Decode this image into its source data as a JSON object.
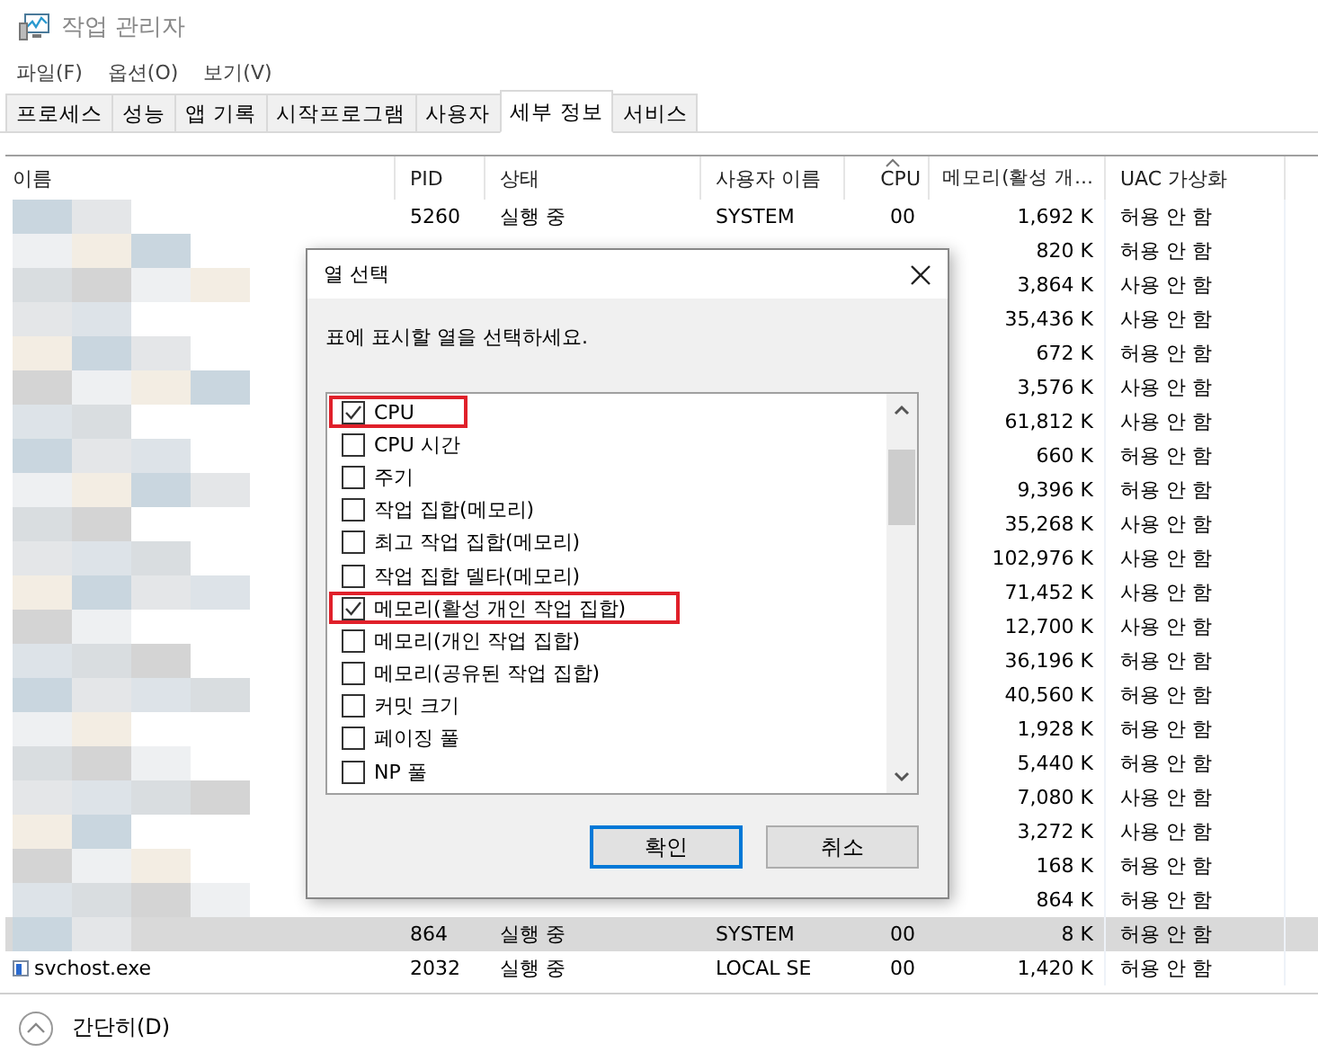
{
  "window": {
    "title": "작업 관리자"
  },
  "menu": [
    "파일(F)",
    "옵션(O)",
    "보기(V)"
  ],
  "tabs": [
    {
      "label": "프로세스",
      "selected": false
    },
    {
      "label": "성능",
      "selected": false
    },
    {
      "label": "앱 기록",
      "selected": false
    },
    {
      "label": "시작프로그램",
      "selected": false
    },
    {
      "label": "사용자",
      "selected": false
    },
    {
      "label": "세부 정보",
      "selected": true
    },
    {
      "label": "서비스",
      "selected": false
    }
  ],
  "table": {
    "columns": [
      {
        "label": "이름",
        "sorted": false
      },
      {
        "label": "PID",
        "sorted": false
      },
      {
        "label": "상태",
        "sorted": false
      },
      {
        "label": "사용자 이름",
        "sorted": false
      },
      {
        "label": "CPU",
        "sorted": true
      },
      {
        "label": "메모리(활성 개…",
        "sorted": false
      },
      {
        "label": "UAC 가상화",
        "sorted": false
      }
    ],
    "rows": [
      {
        "blurred": true,
        "selected": false,
        "pid": "5260",
        "status": "실행 중",
        "user": "SYSTEM",
        "cpu": "00",
        "memory": "1,692 K",
        "uac": "허용 안 함"
      },
      {
        "blurred": true,
        "selected": false,
        "memory": "820 K",
        "uac": "허용 안 함"
      },
      {
        "blurred": true,
        "selected": false,
        "memory": "3,864 K",
        "uac": "사용 안 함"
      },
      {
        "blurred": true,
        "selected": false,
        "memory": "35,436 K",
        "uac": "사용 안 함"
      },
      {
        "blurred": true,
        "selected": false,
        "memory": "672 K",
        "uac": "허용 안 함"
      },
      {
        "blurred": true,
        "selected": false,
        "memory": "3,576 K",
        "uac": "사용 안 함"
      },
      {
        "blurred": true,
        "selected": false,
        "memory": "61,812 K",
        "uac": "사용 안 함"
      },
      {
        "blurred": true,
        "selected": false,
        "memory": "660 K",
        "uac": "허용 안 함"
      },
      {
        "blurred": true,
        "selected": false,
        "memory": "9,396 K",
        "uac": "허용 안 함"
      },
      {
        "blurred": true,
        "selected": false,
        "memory": "35,268 K",
        "uac": "사용 안 함"
      },
      {
        "blurred": true,
        "selected": false,
        "memory": "102,976 K",
        "uac": "사용 안 함"
      },
      {
        "blurred": true,
        "selected": false,
        "memory": "71,452 K",
        "uac": "사용 안 함"
      },
      {
        "blurred": true,
        "selected": false,
        "memory": "12,700 K",
        "uac": "사용 안 함"
      },
      {
        "blurred": true,
        "selected": false,
        "memory": "36,196 K",
        "uac": "허용 안 함"
      },
      {
        "blurred": true,
        "selected": false,
        "memory": "40,560 K",
        "uac": "허용 안 함"
      },
      {
        "blurred": true,
        "selected": false,
        "memory": "1,928 K",
        "uac": "허용 안 함"
      },
      {
        "blurred": true,
        "selected": false,
        "memory": "5,440 K",
        "uac": "허용 안 함"
      },
      {
        "blurred": true,
        "selected": false,
        "memory": "7,080 K",
        "uac": "사용 안 함"
      },
      {
        "blurred": true,
        "selected": false,
        "memory": "3,272 K",
        "uac": "사용 안 함"
      },
      {
        "blurred": true,
        "selected": false,
        "memory": "168 K",
        "uac": "허용 안 함"
      },
      {
        "blurred": true,
        "selected": false,
        "memory": "864 K",
        "uac": "허용 안 함"
      },
      {
        "blurred": true,
        "selected": true,
        "pid": "864",
        "status": "실행 중",
        "user": "SYSTEM",
        "cpu": "00",
        "memory": "8 K",
        "uac": "허용 안 함"
      },
      {
        "blurred": false,
        "selected": false,
        "name": "svchost.exe",
        "pid": "2032",
        "status": "실행 중",
        "user": "LOCAL SE",
        "cpu": "00",
        "memory": "1,420 K",
        "uac": "허용 안 함"
      }
    ]
  },
  "footer": {
    "label": "간단히(D)"
  },
  "dialog": {
    "title": "열 선택",
    "instruction": "표에 표시할 열을 선택하세요.",
    "options": [
      {
        "label": "CPU",
        "checked": true,
        "highlighted": true
      },
      {
        "label": "CPU 시간",
        "checked": false,
        "highlighted": false
      },
      {
        "label": "주기",
        "checked": false,
        "highlighted": false
      },
      {
        "label": "작업 집합(메모리)",
        "checked": false,
        "highlighted": false
      },
      {
        "label": "최고 작업 집합(메모리)",
        "checked": false,
        "highlighted": false
      },
      {
        "label": "작업 집합 델타(메모리)",
        "checked": false,
        "highlighted": false
      },
      {
        "label": "메모리(활성 개인 작업 집합)",
        "checked": true,
        "highlighted": true
      },
      {
        "label": "메모리(개인 작업 집합)",
        "checked": false,
        "highlighted": false
      },
      {
        "label": "메모리(공유된 작업 집합)",
        "checked": false,
        "highlighted": false
      },
      {
        "label": "커밋 크기",
        "checked": false,
        "highlighted": false
      },
      {
        "label": "페이징 풀",
        "checked": false,
        "highlighted": false
      },
      {
        "label": "NP 풀",
        "checked": false,
        "highlighted": false
      }
    ],
    "buttons": [
      {
        "label": "확인",
        "default": true
      },
      {
        "label": "취소",
        "default": false
      }
    ]
  }
}
